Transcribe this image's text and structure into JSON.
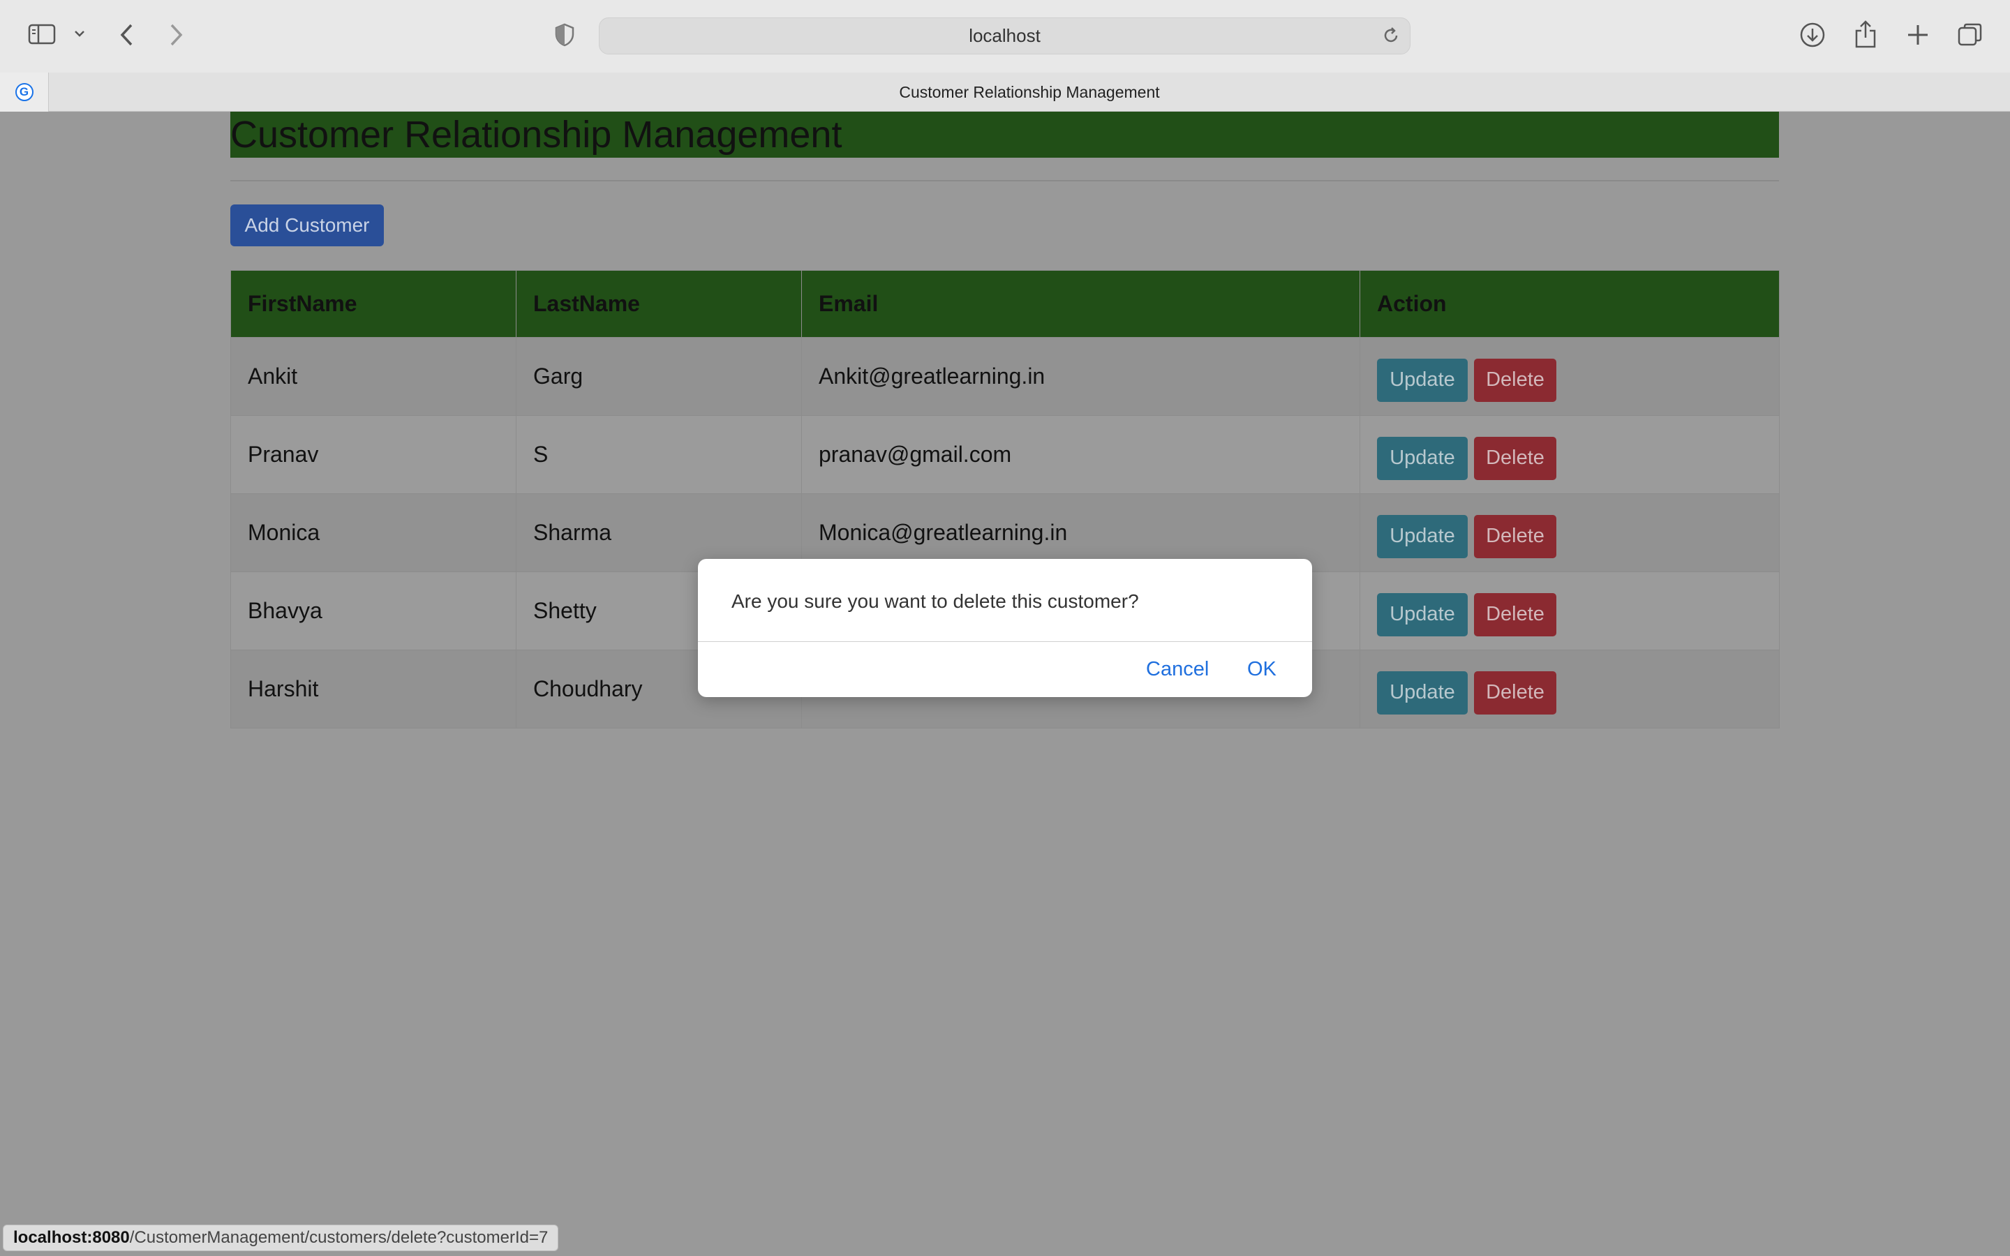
{
  "browser": {
    "url": "localhost",
    "tab_title": "Customer Relationship Management"
  },
  "page": {
    "title": "Customer Relationship Management",
    "add_button": "Add Customer",
    "columns": [
      "FirstName",
      "LastName",
      "Email",
      "Action"
    ],
    "rows": [
      {
        "first": "Ankit",
        "last": "Garg",
        "email": "Ankit@greatlearning.in"
      },
      {
        "first": "Pranav",
        "last": "S",
        "email": "pranav@gmail.com"
      },
      {
        "first": "Monica",
        "last": "Sharma",
        "email": "Monica@greatlearning.in"
      },
      {
        "first": "Bhavya",
        "last": "Shetty",
        "email": ""
      },
      {
        "first": "Harshit",
        "last": "Choudhary",
        "email": ""
      }
    ],
    "update_label": "Update",
    "delete_label": "Delete"
  },
  "dialog": {
    "message": "Are you sure you want to delete this customer?",
    "cancel": "Cancel",
    "ok": "OK"
  },
  "status_bar": {
    "host": "localhost:8080",
    "path": "/CustomerManagement/customers/delete?customerId=7"
  },
  "colors": {
    "header_green": "#214f17",
    "primary_button": "#2a4f98",
    "update_button": "#2e6a7a",
    "delete_button": "#8b2a31",
    "dialog_link": "#1f6fde"
  },
  "icons": {
    "sidebar": "sidebar-icon",
    "back": "chevron-left-icon",
    "forward": "chevron-right-icon",
    "privacy": "shield-icon",
    "reload": "reload-icon",
    "download": "download-icon",
    "share": "share-icon",
    "new_tab": "plus-icon",
    "tab_overview": "tabs-icon"
  }
}
